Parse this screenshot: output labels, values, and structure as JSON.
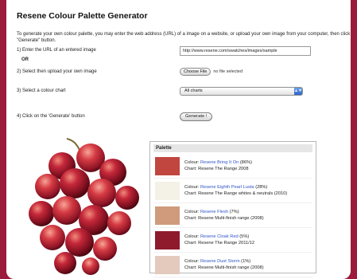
{
  "page": {
    "title": "Resene Colour Palette Generator",
    "intro": "To generate your own colour palette, you may enter the web address (URL) of a image on a website, or upload your own image from your computer, then click the \"Generate\" button."
  },
  "form": {
    "step1_label": "1) Enter the URL of an entered image",
    "url_value": "http://www.resene.com/swatches/images/sample",
    "or_label": "OR",
    "step2_label": "2) Select then upload your own image",
    "choose_file_label": "Choose File",
    "file_status": "no file selected",
    "step3_label": "3) Select a colour chart",
    "chart_selected": "All charts",
    "step4_label": "4) Click on the 'Generate' button",
    "generate_label": "Generate !"
  },
  "palette": {
    "header": "Palette",
    "colour_prefix": "Colour:",
    "chart_prefix": "Chart:",
    "items": [
      {
        "colour": "Resene Bring It On",
        "percent": "(86%)",
        "chart": "Resene The Range 2008",
        "hex": "#c0463f"
      },
      {
        "colour": "Resene Eighth Pearl Lusta",
        "percent": "(28%)",
        "chart": "Resene The Range whites & neutrals (2010)",
        "hex": "#f4f1e6"
      },
      {
        "colour": "Resene Flesh",
        "percent": "(7%)",
        "chart": "Resene Multi-finish range (2008)",
        "hex": "#cf9b7c"
      },
      {
        "colour": "Resene Cloak Red",
        "percent": "(5%)",
        "chart": "Resene The Range 2011/12",
        "hex": "#8e1a2c"
      },
      {
        "colour": "Resene Dust Storm",
        "percent": "(1%)",
        "chart": "Resene Multi-finish range (2008)",
        "hex": "#e3cabd"
      }
    ]
  },
  "colors": {
    "background": "#9c1a3c",
    "link": "#2f55c9"
  }
}
